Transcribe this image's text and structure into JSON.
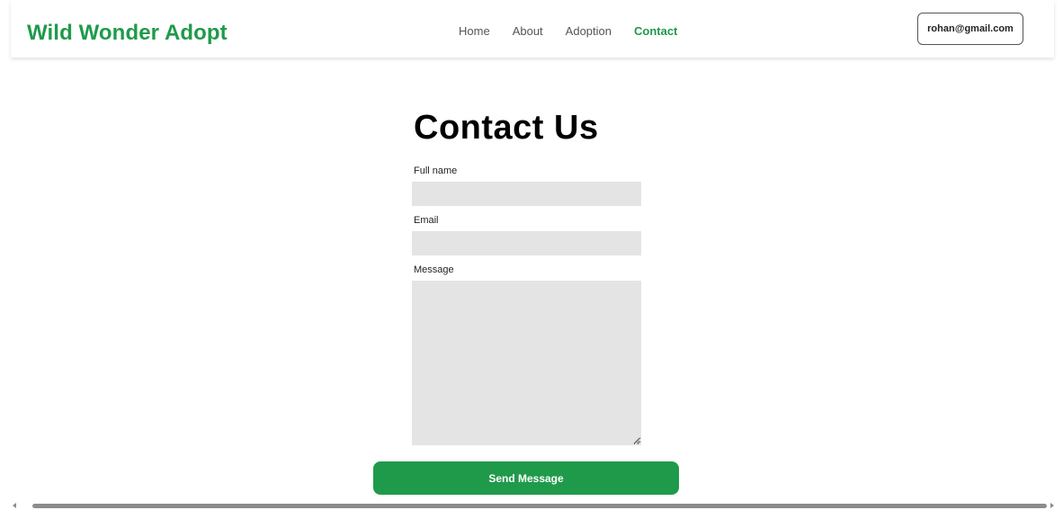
{
  "header": {
    "brand": "Wild Wonder Adopt",
    "nav": [
      {
        "label": "Home",
        "active": false
      },
      {
        "label": "About",
        "active": false
      },
      {
        "label": "Adoption",
        "active": false
      },
      {
        "label": "Contact",
        "active": true
      }
    ],
    "user_email": "rohan@gmail.com"
  },
  "form": {
    "title": "Contact Us",
    "full_name_label": "Full name",
    "full_name_value": "",
    "email_label": "Email",
    "email_value": "",
    "message_label": "Message",
    "message_value": "",
    "submit_label": "Send Message"
  },
  "colors": {
    "accent": "#1f9a4b",
    "field_background": "#e4e4e4",
    "text": "#111111"
  },
  "icons": {
    "scroll_left": "chevron-left-icon",
    "scroll_right": "chevron-right-icon",
    "resize_grip": "resize-grip-icon"
  }
}
